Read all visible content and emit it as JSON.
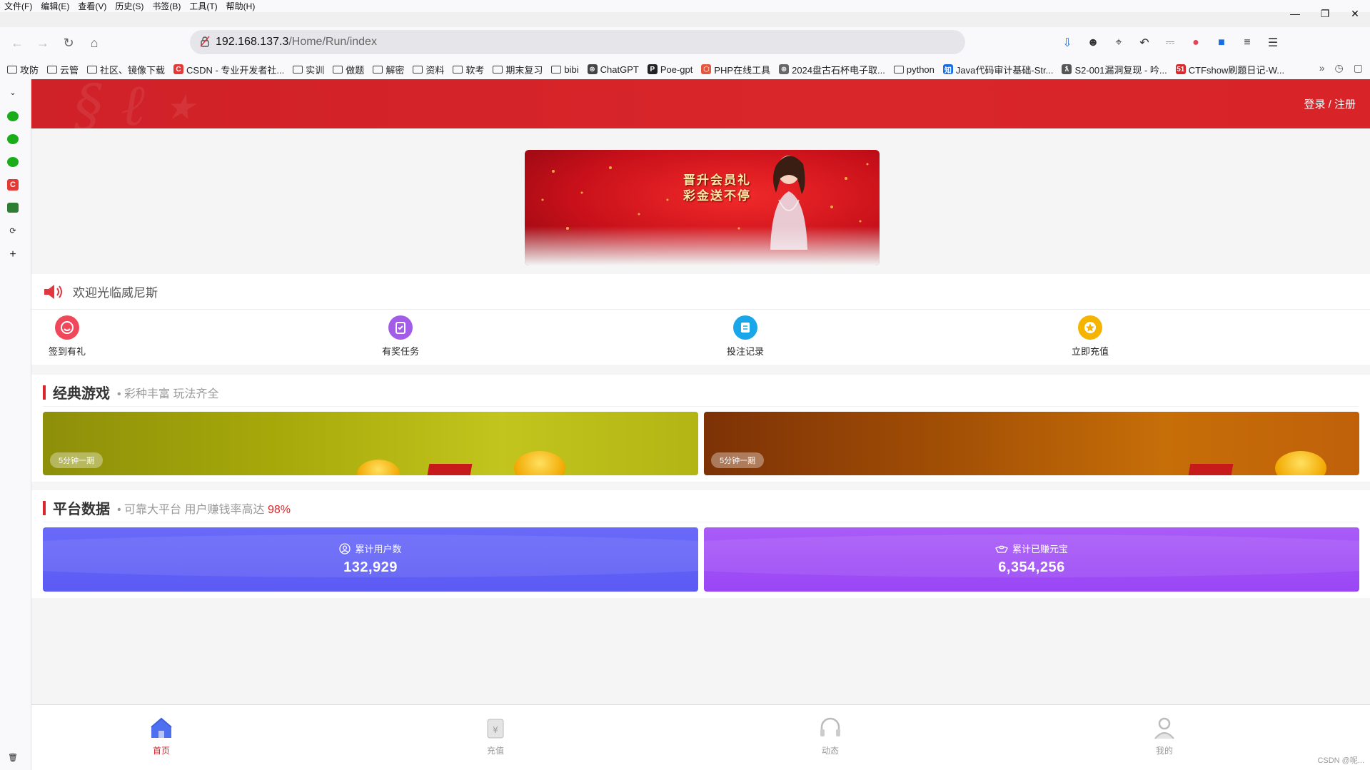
{
  "browser": {
    "menu": [
      "文件(F)",
      "编辑(E)",
      "查看(V)",
      "历史(S)",
      "书签(B)",
      "工具(T)",
      "帮助(H)"
    ],
    "url_host": "192.168.137.3",
    "url_path": "/Home/Run/index",
    "bookmarks": [
      {
        "label": "攻防",
        "kind": "folder"
      },
      {
        "label": "云管",
        "kind": "folder"
      },
      {
        "label": "社区、镜像下载",
        "kind": "folder"
      },
      {
        "label": "CSDN - 专业开发者社...",
        "kind": "csdn"
      },
      {
        "label": "实训",
        "kind": "folder"
      },
      {
        "label": "做题",
        "kind": "folder"
      },
      {
        "label": "解密",
        "kind": "folder"
      },
      {
        "label": "资料",
        "kind": "folder"
      },
      {
        "label": "软考",
        "kind": "folder"
      },
      {
        "label": "期末复习",
        "kind": "folder"
      },
      {
        "label": "bibi",
        "kind": "folder"
      },
      {
        "label": "ChatGPT",
        "kind": "gpt"
      },
      {
        "label": "Poe-gpt",
        "kind": "poe"
      },
      {
        "label": "PHP在线工具",
        "kind": "php"
      },
      {
        "label": "2024盘古石杯电子取...",
        "kind": "globe"
      },
      {
        "label": "python",
        "kind": "folder"
      },
      {
        "label": "Java代码审计基础-Str...",
        "kind": "zhihu"
      },
      {
        "label": "S2-001漏洞复现 - 吟...",
        "kind": "s2"
      },
      {
        "label": "CTFshow刷题日记-W...",
        "kind": "fiveone"
      }
    ]
  },
  "site": {
    "login_text": "登录 / 注册",
    "banner_line1": "晋升会员礼",
    "banner_line2": "彩金送不停",
    "notice": "欢迎光临威尼斯",
    "quick": [
      {
        "label": "签到有礼",
        "color": "#f0475a"
      },
      {
        "label": "有奖任务",
        "color": "#a25ce8"
      },
      {
        "label": "投注记录",
        "color": "#1aa7ea"
      },
      {
        "label": "立即充值",
        "color": "#f5b400"
      }
    ],
    "games_section": {
      "title": "经典游戏",
      "subtitle": "• 彩种丰富 玩法齐全",
      "games": [
        {
          "tag": "5分钟一期"
        },
        {
          "tag": "5分钟一期"
        }
      ]
    },
    "stats_section": {
      "title": "平台数据",
      "subtitle": "• 可靠大平台 用户赚钱率高达",
      "rate": "98%",
      "stats": [
        {
          "label": "累计用户数",
          "value": "132,929"
        },
        {
          "label": "累计已赚元宝",
          "value": "6,354,256"
        }
      ]
    },
    "tabs": [
      {
        "label": "首页",
        "active": true
      },
      {
        "label": "充值",
        "active": false
      },
      {
        "label": "动态",
        "active": false
      },
      {
        "label": "我的",
        "active": false
      }
    ],
    "watermark": "CSDN @呢..."
  }
}
